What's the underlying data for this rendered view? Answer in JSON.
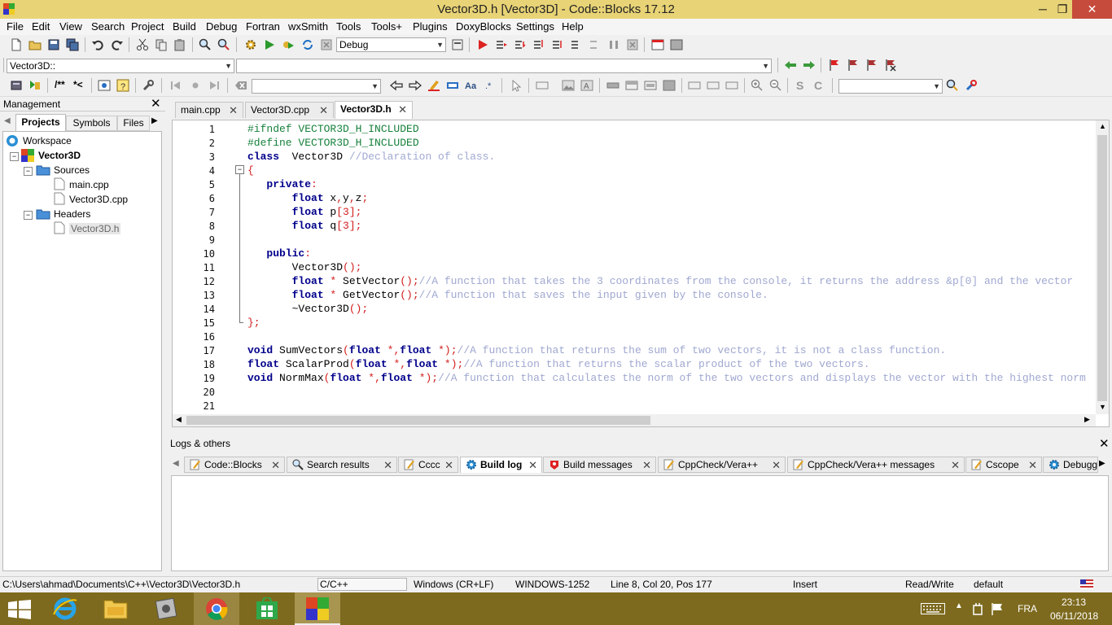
{
  "window": {
    "title": "Vector3D.h [Vector3D] - Code::Blocks 17.12",
    "min": "─",
    "max": "❐",
    "close": "✕"
  },
  "menu": [
    "File",
    "Edit",
    "View",
    "Search",
    "Project",
    "Build",
    "Debug",
    "Fortran",
    "wxSmith",
    "Tools",
    "Tools+",
    "Plugins",
    "DoxyBlocks",
    "Settings",
    "Help"
  ],
  "toolbar": {
    "build_target": "Debug",
    "scope": "Vector3D::",
    "doxy_open": "/**",
    "doxy_close": "*<",
    "search_text": "",
    "symbol_search": ""
  },
  "management": {
    "title": "Management",
    "tabs": [
      "Projects",
      "Symbols",
      "Files"
    ],
    "tree": {
      "workspace": "Workspace",
      "project": "Vector3D",
      "sources": "Sources",
      "source_files": [
        "main.cpp",
        "Vector3D.cpp"
      ],
      "headers": "Headers",
      "header_files": [
        "Vector3D.h"
      ]
    }
  },
  "editor": {
    "tabs": [
      "main.cpp",
      "Vector3D.cpp",
      "Vector3D.h"
    ],
    "active_tab": "Vector3D.h",
    "line_numbers": [
      "1",
      "2",
      "3",
      "4",
      "5",
      "6",
      "7",
      "8",
      "9",
      "10",
      "11",
      "12",
      "13",
      "14",
      "15",
      "16",
      "17",
      "18",
      "19",
      "20",
      "21"
    ]
  },
  "logs": {
    "title": "Logs & others",
    "tabs": [
      "Code::Blocks",
      "Search results",
      "Cccc",
      "Build log",
      "Build messages",
      "CppCheck/Vera++",
      "CppCheck/Vera++ messages",
      "Cscope",
      "Debugger"
    ]
  },
  "status": {
    "path": "C:\\Users\\ahmad\\Documents\\C++\\Vector3D\\Vector3D.h",
    "language": "C/C++",
    "eol": "Windows (CR+LF)",
    "encoding": "WINDOWS-1252",
    "position": "Line 8, Col 20, Pos 177",
    "mode": "Insert",
    "access": "Read/Write",
    "profile": "default"
  },
  "taskbar": {
    "lang": "FRA",
    "time": "23:13",
    "date": "06/11/2018"
  }
}
